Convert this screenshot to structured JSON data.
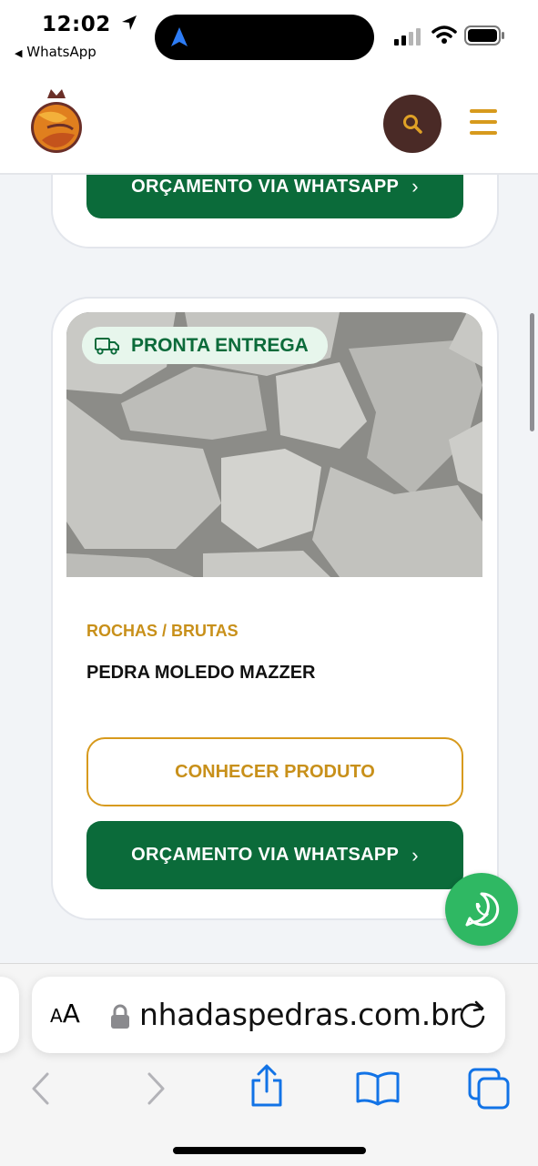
{
  "status_bar": {
    "time": "12:02",
    "back_app": "WhatsApp",
    "icons": [
      "location-arrow-icon",
      "signal-icon",
      "wifi-icon",
      "battery-icon"
    ]
  },
  "header": {
    "logo": "brand-logo",
    "search_icon": "search-icon",
    "menu_icon": "hamburger-menu-icon",
    "colors": {
      "accent": "#d79a1d",
      "search_bg": "#4a2a26"
    }
  },
  "cards": {
    "previous": {
      "whatsapp_button": "ORÇAMENTO VIA WHATSAPP"
    },
    "product": {
      "badge": "PRONTA ENTREGA",
      "badge_icon": "delivery-truck-icon",
      "category": "ROCHAS / BRUTAS",
      "title": "PEDRA MOLEDO MAZZER",
      "details_button": "CONHECER PRODUTO",
      "whatsapp_button": "ORÇAMENTO VIA WHATSAPP"
    }
  },
  "fab": {
    "icon": "whatsapp-icon",
    "color": "#2fb863"
  },
  "browser": {
    "text_size": "AA",
    "url": "nhadaspedras.com.br",
    "toolbar": [
      "back-icon",
      "forward-icon",
      "share-icon",
      "bookmarks-icon",
      "tabs-icon"
    ]
  },
  "colors": {
    "primary_green": "#0b6b3a",
    "gold": "#c8901a"
  }
}
